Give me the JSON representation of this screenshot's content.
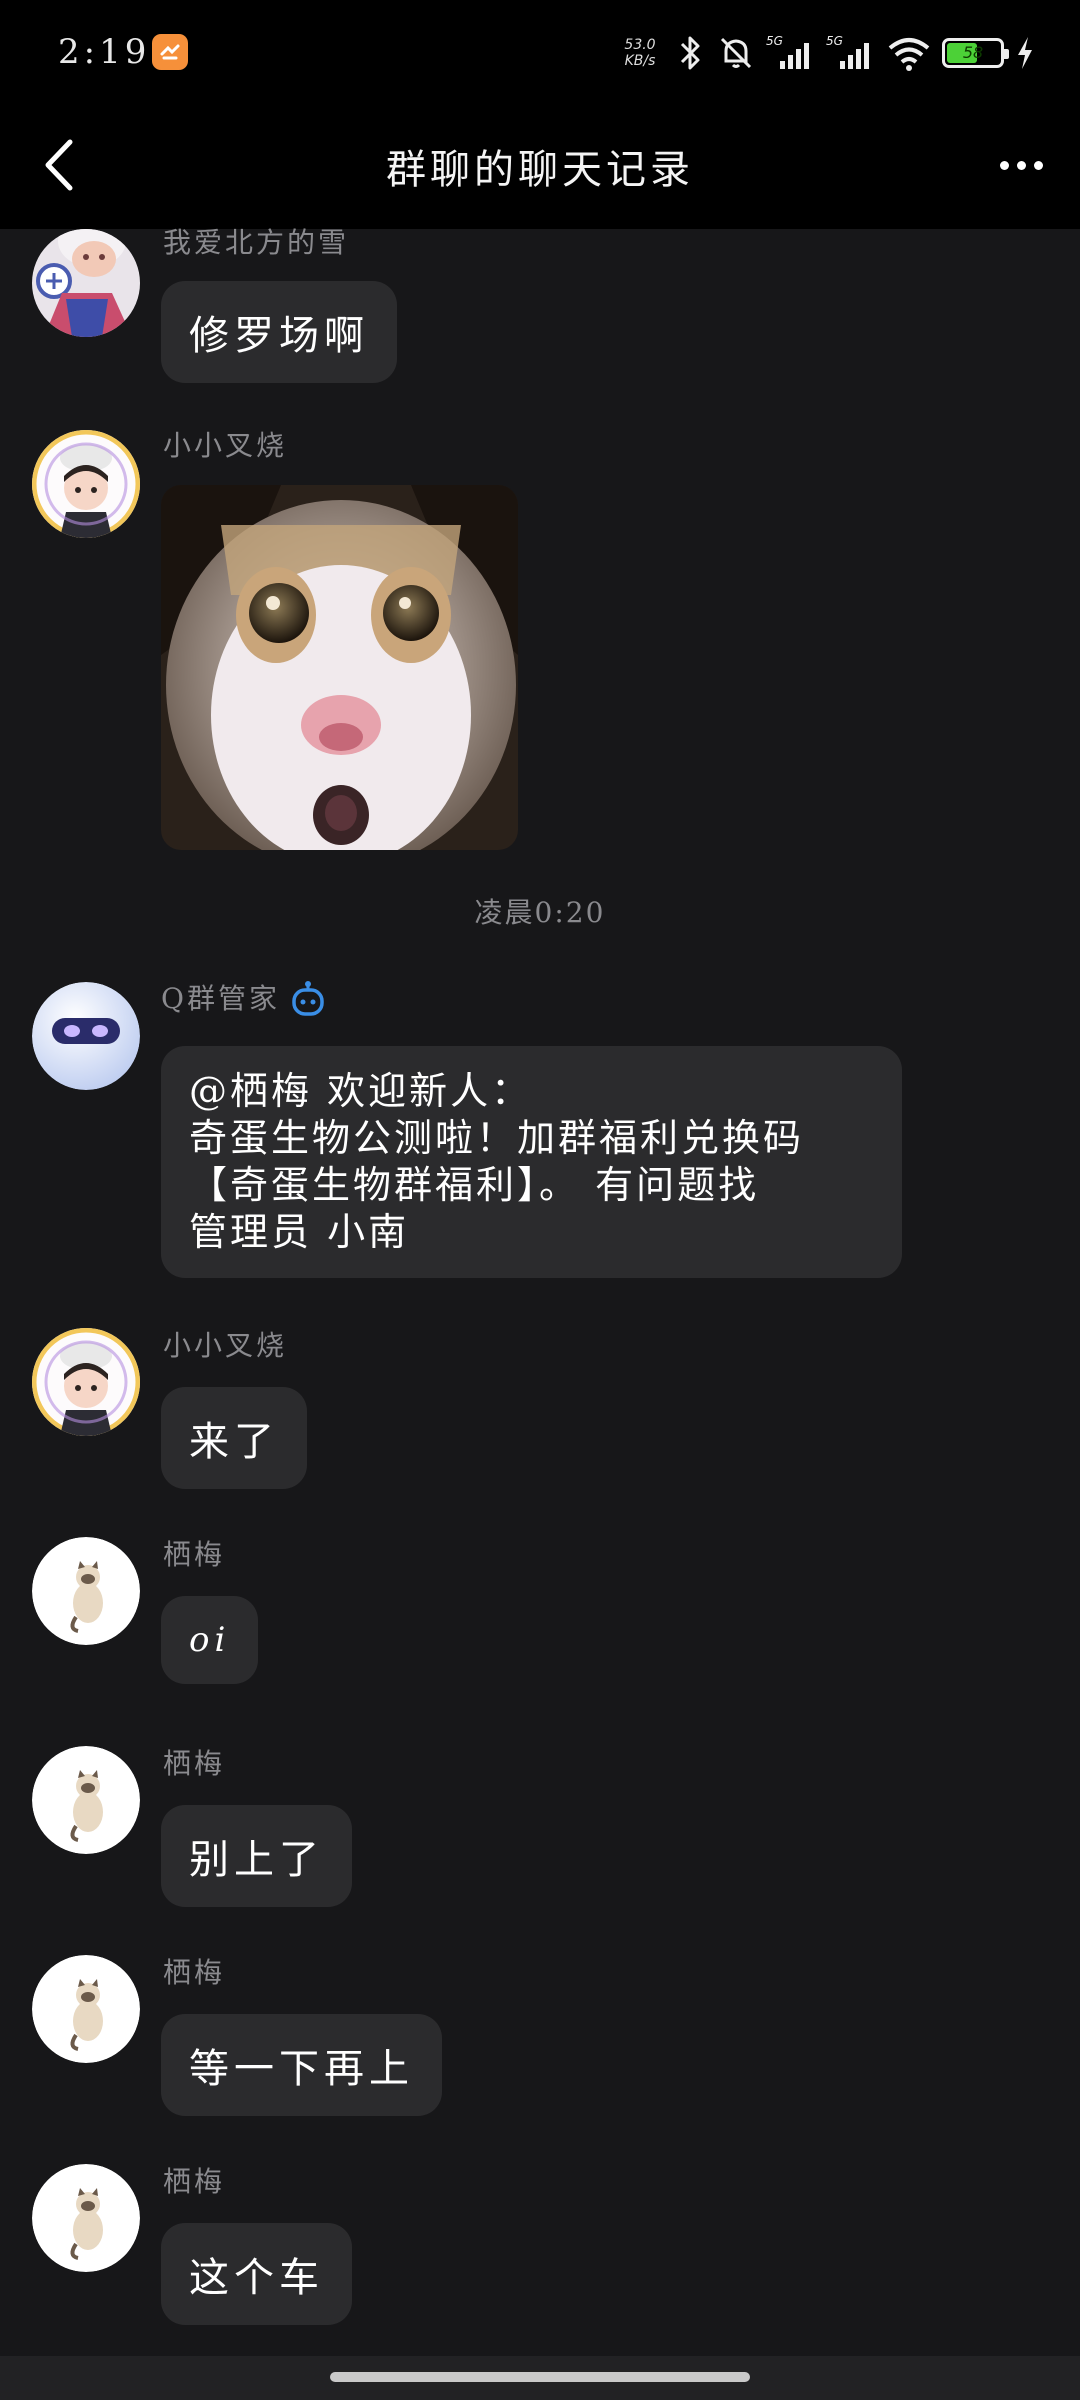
{
  "status_bar": {
    "time": "2:19",
    "net_speed_value": "53.0",
    "net_speed_unit": "KB/s",
    "battery": "58",
    "battery_level": 0.58,
    "icons": [
      "app-badge-icon",
      "bluetooth-icon",
      "mute-icon",
      "signal-5g-icon",
      "signal-5g-icon",
      "wifi-icon",
      "battery-icon",
      "charging-icon"
    ]
  },
  "header": {
    "title": "群聊的聊天记录",
    "back_icon": "chevron-left-icon",
    "more_icon": "more-icon"
  },
  "messages": [
    {
      "sender": "我爱北方的雪",
      "text": "修罗场啊",
      "avatar": "avatar-snow"
    },
    {
      "sender": "小小叉烧",
      "image": "cat-meme",
      "avatar": "avatar-chef"
    },
    {
      "timestamp": "凌晨0:20"
    },
    {
      "sender": "Q群管家",
      "bot_icon": "robot-icon",
      "lines": [
        "@栖梅 欢迎新人：",
        "奇蛋生物公测啦！加群福利兑换码",
        "【奇蛋生物群福利】。  有问题找",
        "管理员 小南"
      ],
      "avatar": "avatar-bot"
    },
    {
      "sender": "小小叉烧",
      "text": "来了",
      "avatar": "avatar-chef"
    },
    {
      "sender": "栖梅",
      "text": "oi",
      "avatar": "avatar-cat"
    },
    {
      "sender": "栖梅",
      "text": "别上了",
      "avatar": "avatar-cat"
    },
    {
      "sender": "栖梅",
      "text": "等一下再上",
      "avatar": "avatar-cat"
    },
    {
      "sender": "栖梅",
      "text": "这个车",
      "avatar": "avatar-cat"
    }
  ],
  "colors": {
    "background": "#171719",
    "bubble": "#2b2b2d",
    "header": "#000000",
    "muted_text": "#8a8a8e",
    "bot_blue": "#3a8ee6",
    "battery_green": "#4cd137"
  }
}
